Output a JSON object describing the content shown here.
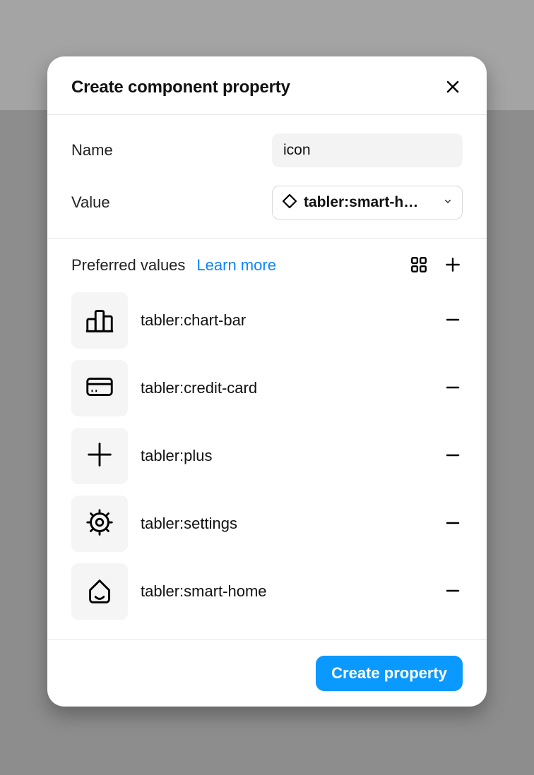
{
  "dialog": {
    "title": "Create component property",
    "name_label": "Name",
    "name_value": "icon",
    "value_label": "Value",
    "value_selected": "tabler:smart-h…"
  },
  "preferred": {
    "title": "Preferred values",
    "learn_more": "Learn more",
    "items": [
      {
        "label": "tabler:chart-bar"
      },
      {
        "label": "tabler:credit-card"
      },
      {
        "label": "tabler:plus"
      },
      {
        "label": "tabler:settings"
      },
      {
        "label": "tabler:smart-home"
      }
    ]
  },
  "footer": {
    "submit_label": "Create property"
  }
}
